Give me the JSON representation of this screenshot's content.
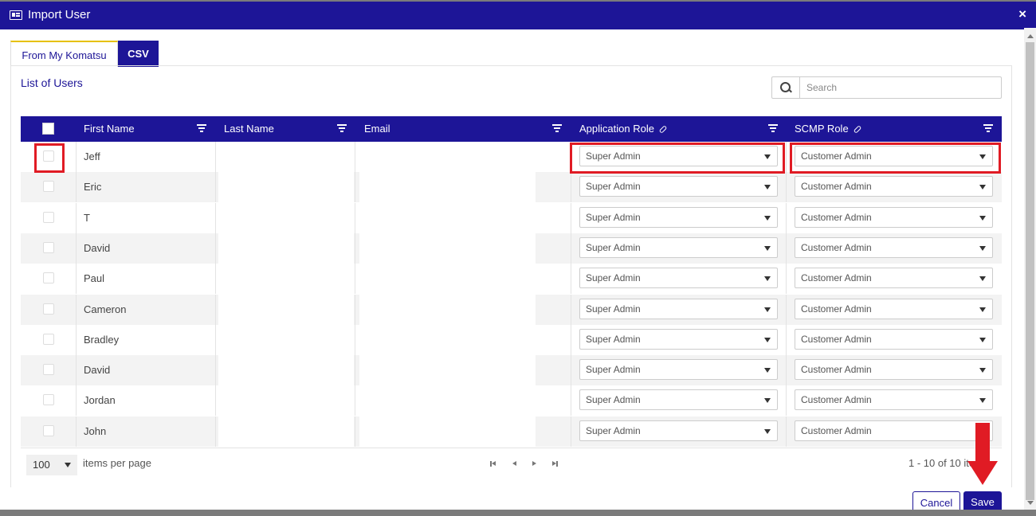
{
  "dialog": {
    "title": "Import User",
    "close_glyph": "×"
  },
  "tabs": [
    {
      "label": "From My Komatsu"
    },
    {
      "label": "CSV"
    }
  ],
  "list": {
    "title": "List of Users"
  },
  "search": {
    "placeholder": "Search"
  },
  "columns": {
    "first_name": "First Name",
    "last_name": "Last Name",
    "email": "Email",
    "application_role": "Application Role",
    "scmp_role": "SCMP Role"
  },
  "rows": [
    {
      "first_name": "Jeff",
      "application_role": "Super Admin",
      "scmp_role": "Customer Admin"
    },
    {
      "first_name": "Eric",
      "application_role": "Super Admin",
      "scmp_role": "Customer Admin"
    },
    {
      "first_name": "T",
      "application_role": "Super Admin",
      "scmp_role": "Customer Admin"
    },
    {
      "first_name": "David",
      "application_role": "Super Admin",
      "scmp_role": "Customer Admin"
    },
    {
      "first_name": "Paul",
      "application_role": "Super Admin",
      "scmp_role": "Customer Admin"
    },
    {
      "first_name": "Cameron",
      "application_role": "Super Admin",
      "scmp_role": "Customer Admin"
    },
    {
      "first_name": "Bradley",
      "application_role": "Super Admin",
      "scmp_role": "Customer Admin"
    },
    {
      "first_name": "David",
      "application_role": "Super Admin",
      "scmp_role": "Customer Admin"
    },
    {
      "first_name": "Jordan",
      "application_role": "Super Admin",
      "scmp_role": "Customer Admin"
    },
    {
      "first_name": "John",
      "application_role": "Super Admin",
      "scmp_role": "Customer Admin"
    }
  ],
  "pager": {
    "page_size": "100",
    "items_per_page": "items per page",
    "info": "1 - 10 of 10 items"
  },
  "buttons": {
    "cancel": "Cancel",
    "save": "Save"
  },
  "colors": {
    "brand": "#1d1597",
    "highlight": "#e01b24",
    "accent_tab": "#e6c100"
  }
}
